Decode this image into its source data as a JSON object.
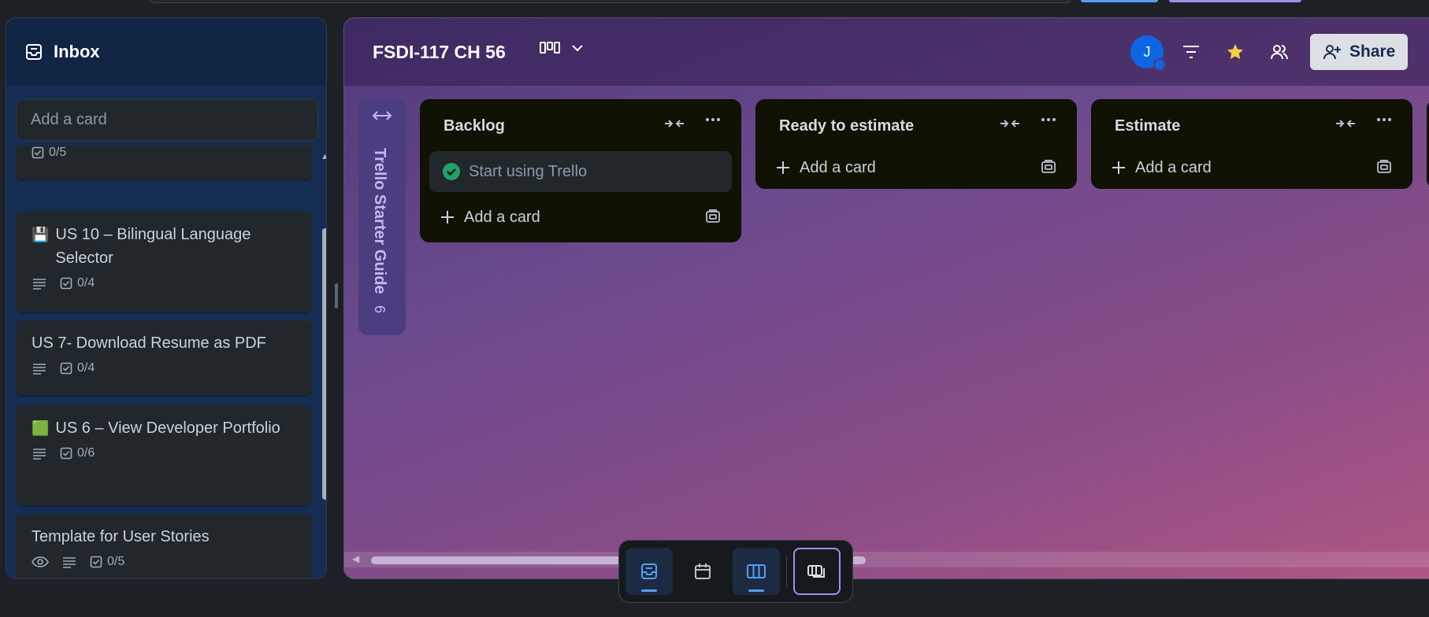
{
  "inbox": {
    "title": "Inbox",
    "add_card_placeholder": "Add a card",
    "cards": [
      {
        "title": "",
        "checklist": "0/5"
      },
      {
        "emoji": "💾",
        "title": "US 10 – Bilingual Language Selector",
        "checklist": "0/4"
      },
      {
        "title": "US 7- Download Resume as PDF",
        "checklist": "0/4"
      },
      {
        "emoji": "🟩",
        "title": "US 6 – View Developer Portfolio",
        "checklist": "0/6"
      },
      {
        "title": "Template for User Stories",
        "checklist": "0/5"
      }
    ]
  },
  "board": {
    "title": "FSDI-117 CH 56",
    "avatar_initial": "J",
    "share_label": "Share",
    "starter_guide": {
      "title": "Trello Starter Guide",
      "count": "6"
    },
    "lists": [
      {
        "name": "Backlog",
        "cards": [
          "Start using Trello"
        ],
        "add_label": "Add a card"
      },
      {
        "name": "Ready to estimate",
        "cards": [],
        "add_label": "Add a card"
      },
      {
        "name": "Estimate",
        "cards": [],
        "add_label": "Add a card"
      }
    ]
  },
  "colors": {
    "accent": "#579dff",
    "board_gradient_start": "#4e3a7a",
    "board_gradient_end": "#b05784",
    "complete_green": "#22a06b",
    "star": "#f5cd47"
  },
  "toolbar": {
    "items": [
      "inbox-icon",
      "calendar-icon",
      "board-icon",
      "switch-boards-icon"
    ]
  }
}
